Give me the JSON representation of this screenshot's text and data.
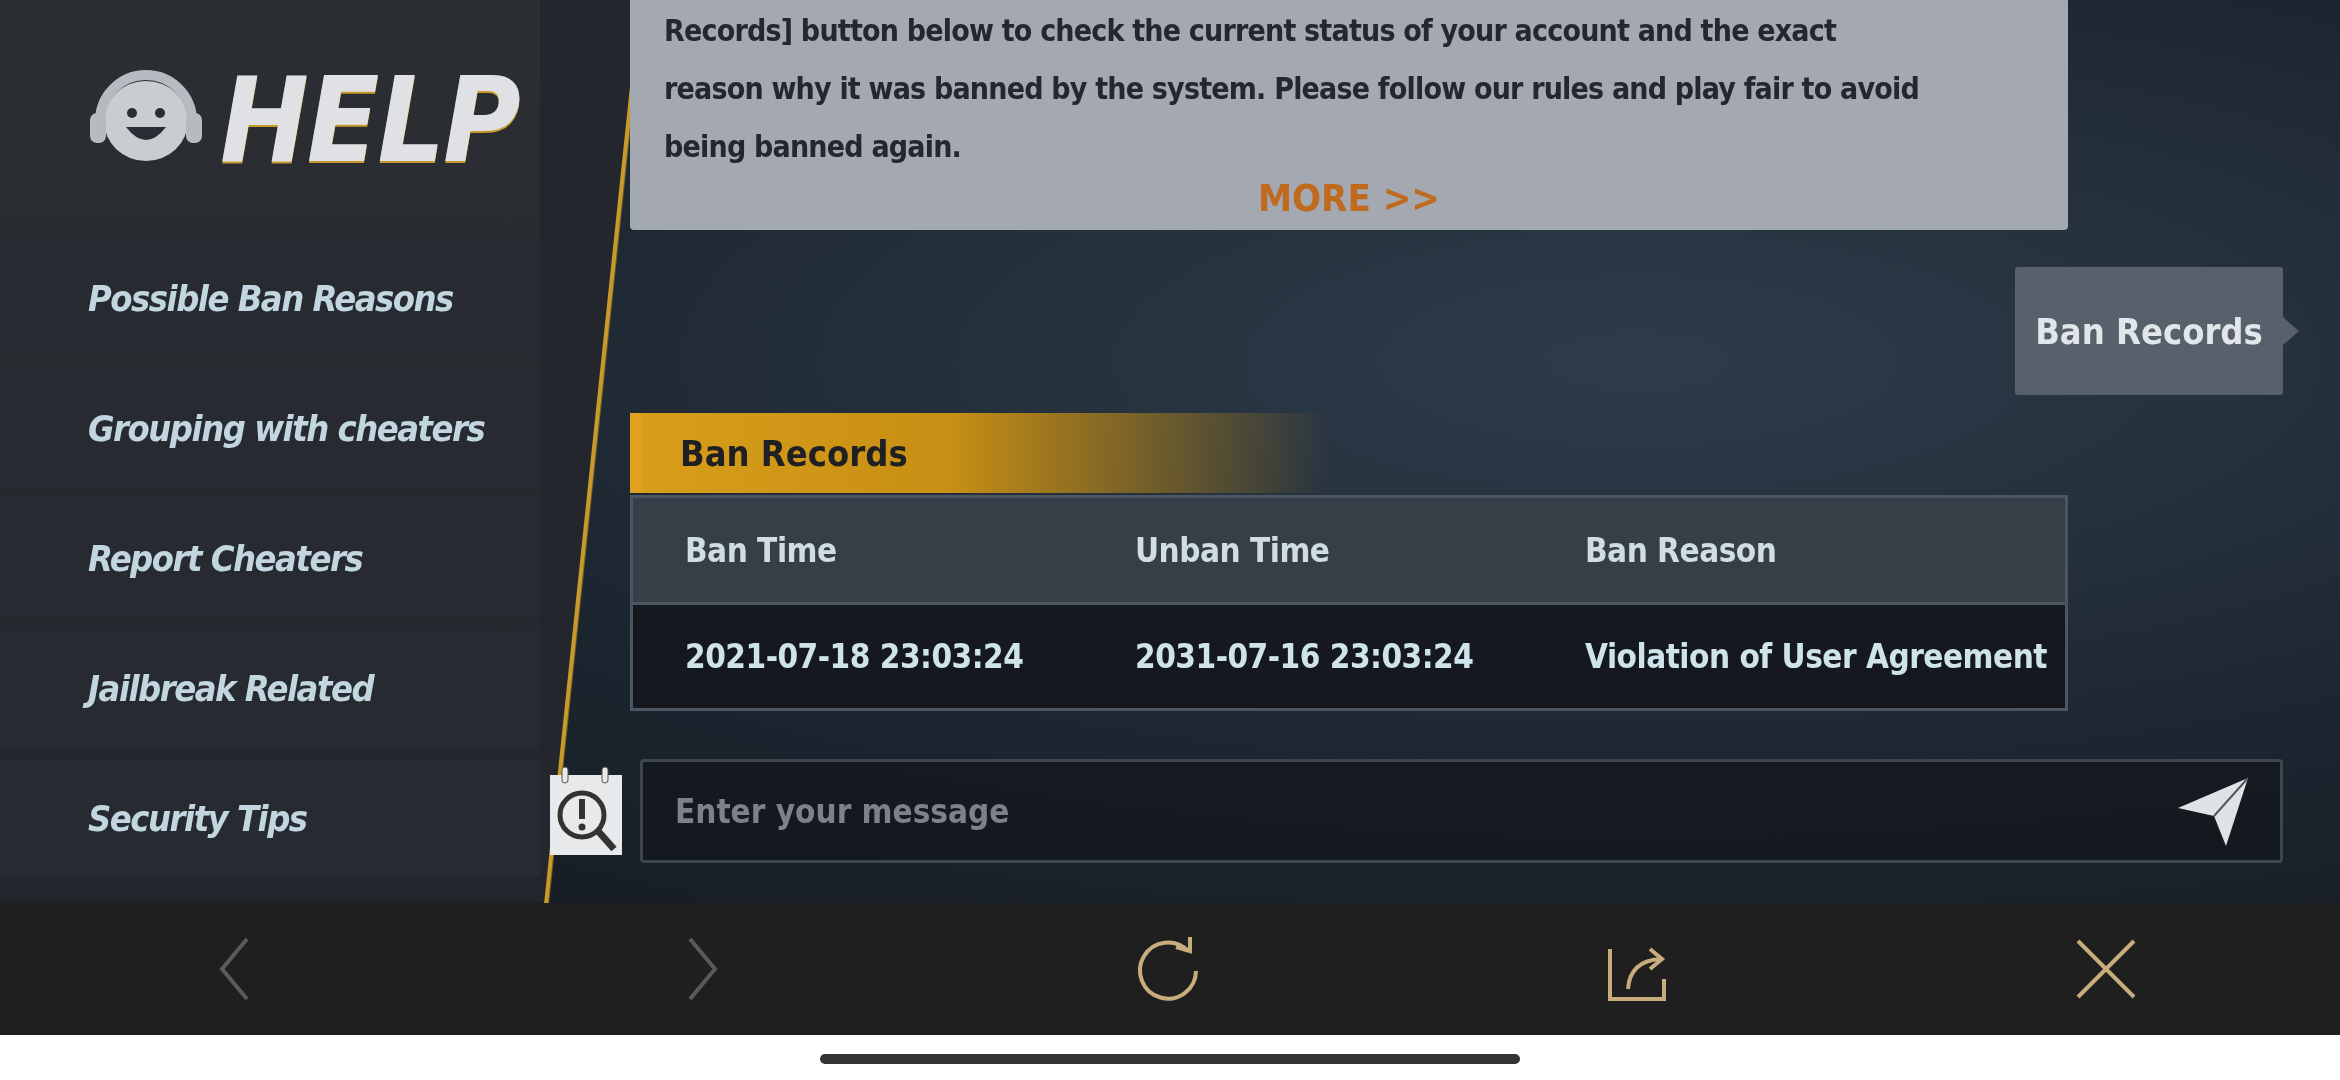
{
  "sidebar": {
    "title": "HELP",
    "items": [
      {
        "label": "Possible Ban Reasons",
        "selected": false
      },
      {
        "label": "Grouping with cheaters",
        "selected": false
      },
      {
        "label": "Report Cheaters",
        "selected": false
      },
      {
        "label": "Jailbreak Related",
        "selected": false
      },
      {
        "label": "Security Tips",
        "selected": false
      }
    ]
  },
  "notice": {
    "lines": [
      "Records] button below to check the current status of your account and the exact",
      "reason why it was banned by the system. Please follow our rules and play fair to avoid",
      "being banned again."
    ],
    "more": "MORE >>"
  },
  "side_tab": {
    "label": "Ban Records"
  },
  "ban_records": {
    "title": "Ban Records",
    "columns": [
      "Ban Time",
      "Unban Time",
      "Ban Reason"
    ],
    "rows": [
      [
        "2021-07-18 23:03:24",
        "2031-07-16 23:03:24",
        "Violation of User Agreement"
      ]
    ]
  },
  "message": {
    "placeholder": "Enter your message"
  },
  "toolbar": [
    {
      "kind": "back",
      "disabled": true
    },
    {
      "kind": "forward",
      "disabled": true
    },
    {
      "kind": "refresh",
      "disabled": false
    },
    {
      "kind": "share",
      "disabled": false
    },
    {
      "kind": "close",
      "disabled": false
    }
  ]
}
